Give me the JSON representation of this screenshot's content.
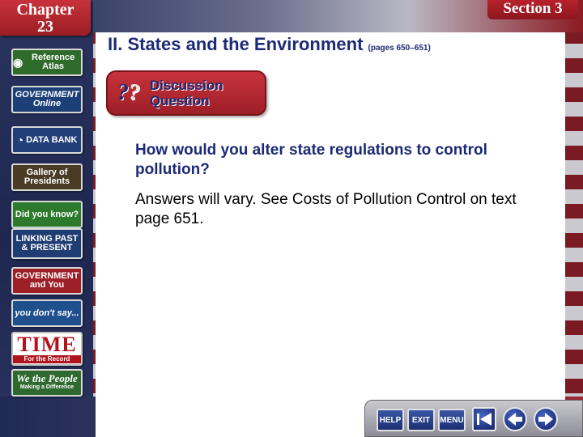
{
  "header": {
    "chapter_label": "Chapter",
    "chapter_number": "23",
    "section_label": "Section 3"
  },
  "nav": {
    "reference_atlas": "Reference Atlas",
    "government_online": "GOVERNMENT Online",
    "data_bank": "DATA BANK",
    "gallery_presidents": "Gallery of Presidents",
    "did_you_know": "Did you know?",
    "linking_past_present": "LINKING PAST & PRESENT",
    "government_and_you": "GOVERNMENT and You",
    "you_dont_say": "you don't say...",
    "time_title": "TIME",
    "time_sub": "For the Record",
    "we_the_people": "We the People",
    "we_the_people_sub": "Making a Difference"
  },
  "slide": {
    "heading": "II. States and the Environment",
    "pages": "(pages 650–651)",
    "badge_q": "?",
    "badge_label_1": "Discussion",
    "badge_label_2": "Question",
    "question": "How would you alter state regulations to control pollution?",
    "answer": "Answers will vary. See Costs of Pollution Control on text page 651."
  },
  "toolbar": {
    "help": "HELP",
    "exit": "EXIT",
    "menu": "MENU"
  },
  "colors": {
    "heading": "#1c2a75",
    "badge": "#b72a32",
    "panel": "#ffffff"
  }
}
